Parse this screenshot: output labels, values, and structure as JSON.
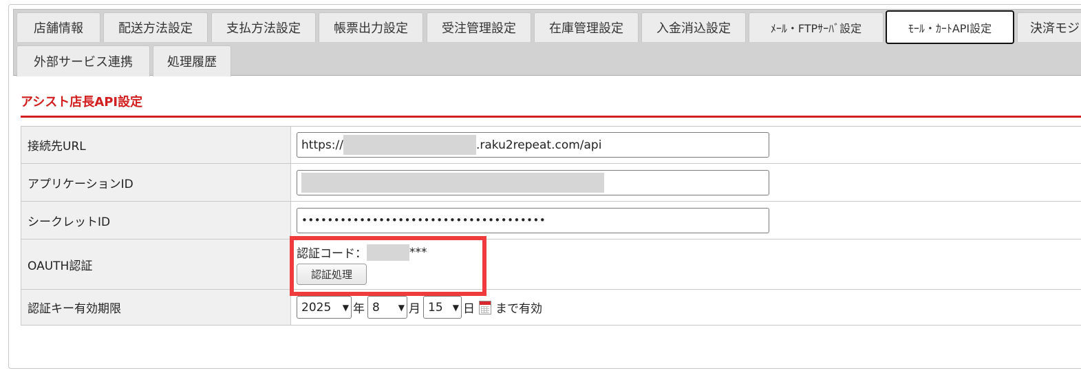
{
  "tabs": {
    "row1": [
      {
        "label": "店舗情報"
      },
      {
        "label": "配送方法設定"
      },
      {
        "label": "支払方法設定"
      },
      {
        "label": "帳票出力設定"
      },
      {
        "label": "受注管理設定"
      },
      {
        "label": "在庫管理設定"
      },
      {
        "label": "入金消込設定"
      },
      {
        "label": "ﾒｰﾙ・FTPｻｰﾊﾞ設定"
      },
      {
        "label": "ﾓｰﾙ・ｶｰﾄAPI設定",
        "active": true
      },
      {
        "label": "決済モジ"
      }
    ],
    "row2": [
      {
        "label": "外部サービス連携"
      },
      {
        "label": "処理履歴"
      }
    ]
  },
  "section": {
    "title": "アシスト店長API設定"
  },
  "form": {
    "url": {
      "label": "接続先URL",
      "prefix": "https://",
      "suffix": ".raku2repeat.com/api"
    },
    "app_id": {
      "label": "アプリケーションID"
    },
    "secret": {
      "label": "シークレットID",
      "value": "••••••••••••••••••••••••••••••••••••••"
    },
    "oauth": {
      "label": "OAUTH認証",
      "code_label": "認証コード：",
      "code_suffix": "***",
      "button": "認証処理"
    },
    "expiry": {
      "label": "認証キー有効期限",
      "year": "2025",
      "year_unit": "年",
      "month": "8",
      "month_unit": "月",
      "day": "15",
      "day_unit": "日",
      "suffix": "まで有効"
    }
  },
  "colors": {
    "accent": "#d21e1e",
    "highlight": "#ef3b3b"
  }
}
